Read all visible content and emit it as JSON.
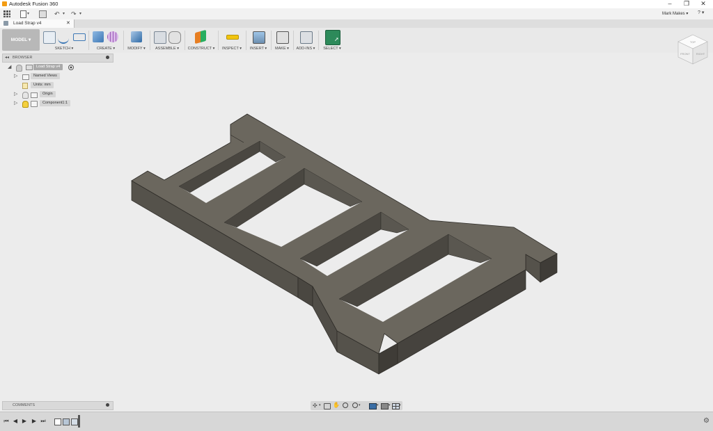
{
  "window": {
    "title": "Autodesk Fusion 360",
    "controls": {
      "minimize": "–",
      "maximize": "❐",
      "close": "✕"
    }
  },
  "quick_access": {
    "user": "Mark Makes ▾",
    "help": "? ▾"
  },
  "document_tab": {
    "title": "Load Strap v4",
    "close": "✕"
  },
  "toolbar": {
    "workspace": "MODEL ▾",
    "groups": [
      {
        "label": "SKETCH ▾"
      },
      {
        "label": "CREATE ▾"
      },
      {
        "label": "MODIFY ▾"
      },
      {
        "label": "ASSEMBLE ▾"
      },
      {
        "label": "CONSTRUCT ▾"
      },
      {
        "label": "INSPECT ▾"
      },
      {
        "label": "INSERT ▾"
      },
      {
        "label": "MAKE ▾"
      },
      {
        "label": "ADD-INS ▾"
      },
      {
        "label": "SELECT ▾"
      }
    ]
  },
  "viewcube": {
    "top": "TOP",
    "front": "FRONT",
    "right": "RIGHT"
  },
  "browser": {
    "title": "BROWSER",
    "collapse": "◂◂",
    "root": "Load Strap v4",
    "nodes": [
      {
        "label": "Named Views"
      },
      {
        "label": "Units: mm"
      },
      {
        "label": "Origin"
      },
      {
        "label": "Component1:1"
      }
    ]
  },
  "comments": {
    "title": "COMMENTS"
  },
  "colors": {
    "model_top": "#6b675e",
    "model_side": "#55524b",
    "model_front": "#4a4741",
    "background": "#ececec"
  }
}
